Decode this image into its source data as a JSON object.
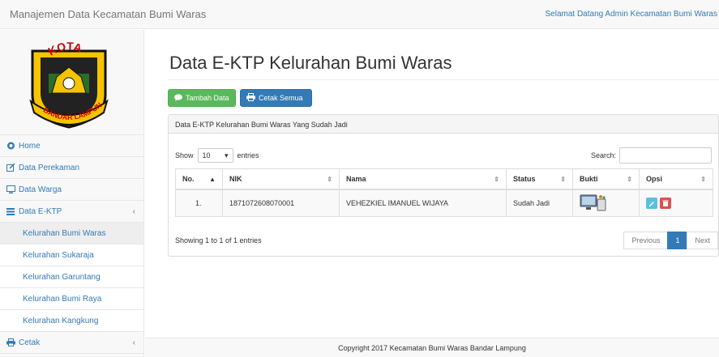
{
  "app": {
    "title": "Manajemen Data Kecamatan Bumi Waras",
    "welcome": "Selamat Datang Admin Kecamatan Bumi Waras"
  },
  "logo": {
    "top_text": "KOTA",
    "bottom_text": "BANDAR LAMPUNG"
  },
  "sidebar": {
    "items": [
      {
        "label": "Home",
        "icon": "dashboard-icon"
      },
      {
        "label": "Data Perekaman",
        "icon": "edit-icon"
      },
      {
        "label": "Data Warga",
        "icon": "monitor-icon"
      },
      {
        "label": "Data E-KTP",
        "icon": "list-icon",
        "expanded": true
      },
      {
        "label": "Kelurahan Bumi Waras",
        "active": true
      },
      {
        "label": "Kelurahan Sukaraja"
      },
      {
        "label": "Kelurahan Garuntang"
      },
      {
        "label": "Kelurahan Bumi Raya"
      },
      {
        "label": "Kelurahan Kangkung"
      },
      {
        "label": "Cetak",
        "icon": "print-icon"
      }
    ]
  },
  "main": {
    "title": "Data E-KTP Kelurahan Bumi Waras",
    "add_button": "Tambah Data",
    "print_button": "Cetak Semua",
    "panel_heading": "Data E-KTP Kelurahan Bumi Waras Yang Sudah Jadi",
    "length": {
      "show": "Show",
      "value": "10",
      "entries": "entries"
    },
    "search_label": "Search:",
    "table": {
      "columns": [
        "No.",
        "NIK",
        "Nama",
        "Status",
        "Bukti",
        "Opsi"
      ],
      "rows": [
        {
          "no": "1.",
          "nik": "1871072608070001",
          "nama": "VEHEZKIEL IMANUEL WIJAYA",
          "status": "Sudah Jadi"
        }
      ]
    },
    "info": "Showing 1 to 1 of 1 entries",
    "pagination": {
      "previous": "Previous",
      "current": "1",
      "next": "Next"
    }
  },
  "footer": {
    "text": "Copyright 2017 Kecamatan Bumi Waras Bandar Lampung"
  },
  "colors": {
    "primary": "#337ab7",
    "success": "#5cb85c",
    "info": "#5bc0de",
    "danger": "#d9534f"
  }
}
